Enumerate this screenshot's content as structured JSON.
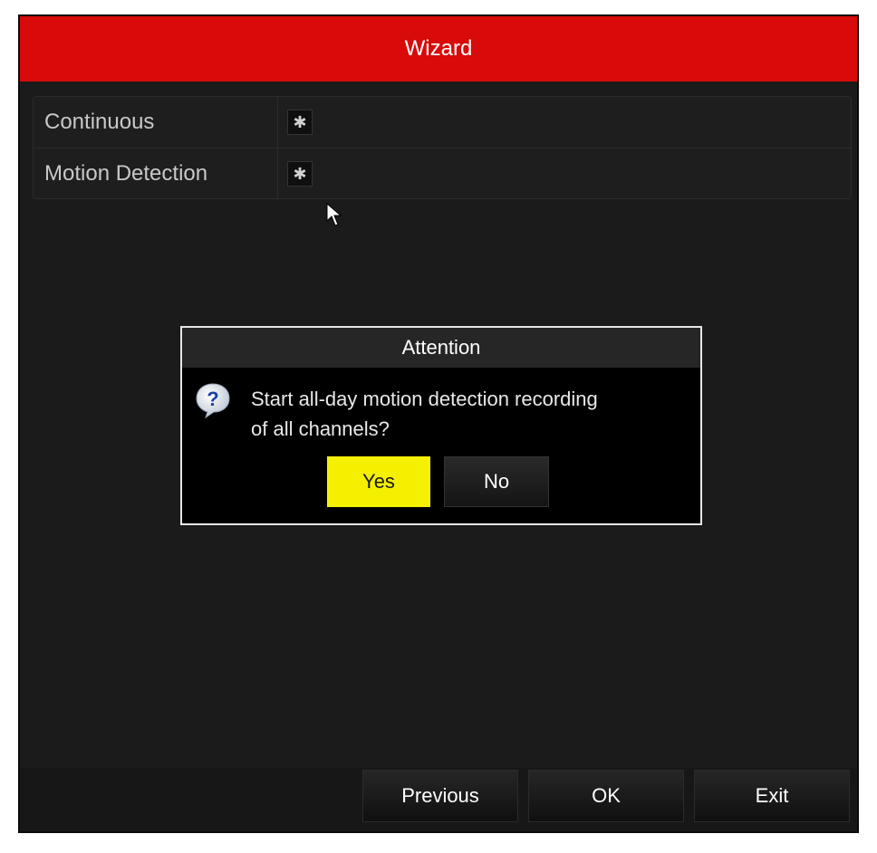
{
  "window": {
    "title": "Wizard"
  },
  "record_types": [
    {
      "label": "Continuous",
      "icon": "gear-icon"
    },
    {
      "label": "Motion Detection",
      "icon": "gear-icon"
    }
  ],
  "dialog": {
    "title": "Attention",
    "message_line1": "Start all-day motion detection recording",
    "message_line2": "of all channels?",
    "icon": "question-icon",
    "yes_label": "Yes",
    "no_label": "No"
  },
  "footer": {
    "previous_label": "Previous",
    "ok_label": "OK",
    "exit_label": "Exit"
  },
  "colors": {
    "title_bar": "#d80a0a",
    "yes_highlight": "#f4f000",
    "background": "#1b1b1b"
  }
}
